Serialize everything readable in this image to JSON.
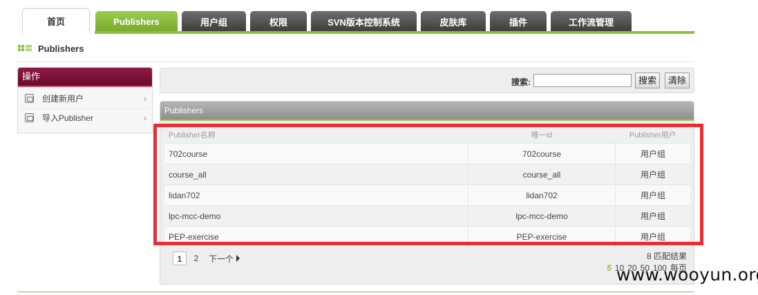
{
  "nav": {
    "tabs": [
      {
        "label": "首页",
        "state": "home"
      },
      {
        "label": "Publishers",
        "state": "active"
      },
      {
        "label": "用户组",
        "state": "normal"
      },
      {
        "label": "权限",
        "state": "normal"
      },
      {
        "label": "SVN版本控制系统",
        "state": "normal"
      },
      {
        "label": "皮肤库",
        "state": "normal"
      },
      {
        "label": "插件",
        "state": "normal"
      },
      {
        "label": "工作流管理",
        "state": "normal"
      }
    ]
  },
  "breadcrumb": {
    "title": "Publishers"
  },
  "sidebar": {
    "header": "操作",
    "items": [
      {
        "label": "创建新用户",
        "icon": "form-icon"
      },
      {
        "label": "导入Publisher",
        "icon": "form-icon"
      }
    ]
  },
  "search": {
    "label": "搜索:",
    "value": "",
    "search_button": "搜索",
    "clear_button": "清除"
  },
  "panel": {
    "title": "Publishers",
    "columns": [
      "Publisher名称",
      "唯一id",
      "Publisher用户"
    ],
    "rows": [
      [
        "702course",
        "702course",
        "用户组"
      ],
      [
        "course_all",
        "course_all",
        "用户组"
      ],
      [
        "lidan702",
        "lidan702",
        "用户组"
      ],
      [
        "lpc-mcc-demo",
        "lpc-mcc-demo",
        "用户组"
      ],
      [
        "PEP-exercise",
        "PEP-exercise",
        "用户组"
      ]
    ],
    "pagination": {
      "pages": [
        "1",
        "2"
      ],
      "current": "1",
      "next_label": "下一个"
    },
    "result_count": "8 匹配结果",
    "per_page": {
      "options": [
        "5",
        "10",
        "20",
        "50",
        "100"
      ],
      "current": "5",
      "suffix": "每页"
    }
  },
  "watermark": "www.wooyun.org",
  "colors": {
    "accent": "#8fbd3f",
    "sidebar_header": "#7a1035",
    "highlight_box": "#f02a33"
  }
}
